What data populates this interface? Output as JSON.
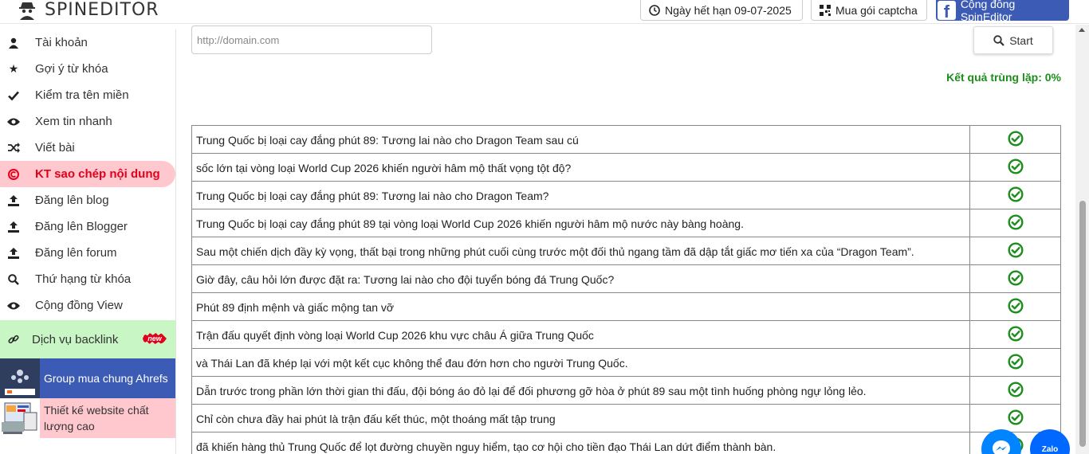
{
  "header": {
    "logo_text": "SPINEDITOR",
    "expiry_label": "Ngày hết hạn 09-07-2025",
    "captcha_label": "Mua gói captcha",
    "community_label": "Cộng đồng SpinEditor"
  },
  "sidebar": {
    "items": [
      {
        "label": "Tài khoản",
        "icon": "user-icon"
      },
      {
        "label": "Gợi ý từ khóa",
        "icon": "star-icon"
      },
      {
        "label": "Kiểm tra tên miền",
        "icon": "check-icon"
      },
      {
        "label": "Xem tin nhanh",
        "icon": "eye-icon"
      },
      {
        "label": "Viết bài",
        "icon": "shuffle-icon"
      },
      {
        "label": "KT sao chép nội dung",
        "icon": "copyright-icon"
      },
      {
        "label": "Đăng lên blog",
        "icon": "upload-icon"
      },
      {
        "label": "Đăng lên Blogger",
        "icon": "upload-icon"
      },
      {
        "label": "Đăng lên forum",
        "icon": "upload-icon"
      },
      {
        "label": "Thứ hạng từ khóa",
        "icon": "search-icon"
      },
      {
        "label": "Cộng đồng View",
        "icon": "eye-icon"
      }
    ],
    "backlink": {
      "label": "Dịch vụ backlink",
      "badge": "new"
    },
    "promo_ahrefs": "Group mua chung Ahrefs",
    "promo_website": "Thiết kế website chất lượng cao"
  },
  "main": {
    "url_placeholder": "http://domain.com",
    "start_label": "Start",
    "result_label": "Kết quả trùng lặp: 0%",
    "rows": [
      "Trung Quốc bị loại cay đắng phút 89: Tương lai nào cho Dragon Team sau cú",
      "sốc lớn tại vòng loại World Cup 2026 khiến người hâm mộ thất vọng tột độ?",
      "Trung Quốc bị loại cay đắng phút 89: Tương lai nào cho Dragon Team?",
      "Trung Quốc bị loại cay đắng phút 89 tại vòng loại World Cup 2026 khiến người hâm mộ nước này bàng hoàng.",
      "Sau một chiến dịch đầy kỳ vọng, thất bại trong những phút cuối cùng trước một đối thủ ngang tầm đã dập tắt giấc mơ tiến xa của “Dragon Team”.",
      "Giờ đây, câu hỏi lớn được đặt ra: Tương lai nào cho đội tuyển bóng đá Trung Quốc?",
      "Phút 89 định mệnh và giấc mộng tan vỡ",
      "Trận đấu quyết định vòng loại World Cup 2026 khu vực châu Á giữa Trung Quốc",
      "và Thái Lan đã khép lại với một kết cục không thể đau đớn hơn cho người Trung Quốc.",
      "Dẫn trước trong phần lớn thời gian thi đấu, đội bóng áo đỏ lại để đối phương gỡ hòa ở phút 89 sau một tình huống phòng ngự lỏng lẻo.",
      "Chỉ còn chưa đầy hai phút là trận đấu kết thúc, một thoáng mất tập trung",
      "đã khiến hàng thủ Trung Quốc để lọt đường chuyền nguy hiểm, tạo cơ hội cho tiền đạo Thái Lan dứt điểm thành bàn."
    ]
  },
  "chat": {
    "zalo_label": "Zalo"
  },
  "colors": {
    "accent_blue": "#3b5bb5",
    "active_red": "#e3001b",
    "success_green": "#1b8e1b"
  }
}
